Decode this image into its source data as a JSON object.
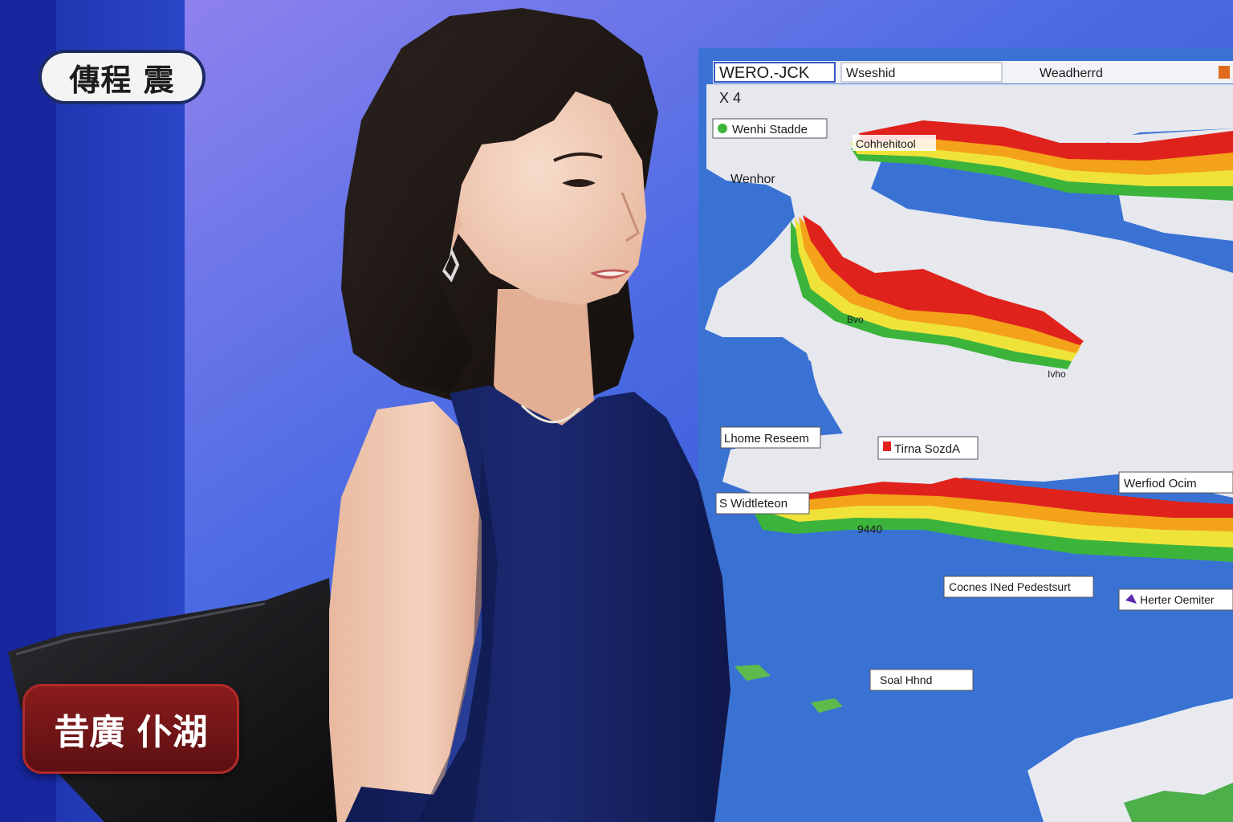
{
  "overlay": {
    "logo_text": "傳程 震",
    "caption_text": "昔廣 仆湖"
  },
  "map": {
    "header": {
      "brand": "WERO.-JCK",
      "left_label": "Wseshid",
      "right_label": "Weadherrd"
    },
    "scale_text": "X 4",
    "labels": {
      "werni_stadde": "Wenhi Stadde",
      "cohhehitool": "Cohhehitool",
      "wenhor": "Wenhor",
      "bvo": "Bvo",
      "ivho": "Ivho",
      "thome_reseem": "Lhome Reseem",
      "tirna_sozdla": "Tirna SozdA",
      "werfiod_ocim": "Werfiod Ocim",
      "s_wildlenteon": "S Widtleteon",
      "num_940": "9440",
      "cocnes_pedestsurt": "Cocnes INed Pedestsurt",
      "herter_oemter": "Herter Oemiter",
      "soal_hhnd": "Soal Hhnd"
    }
  },
  "colors": {
    "studio_blue": "#2b4fd6",
    "studio_violet": "#8a86f0",
    "map_land": "#e6e8ee",
    "map_water": "#3b76d6",
    "dress_navy": "#16205e",
    "band_red": "#e0221c",
    "band_orange": "#f3a21a",
    "band_yellow": "#efe33a",
    "band_green": "#3cb43b"
  }
}
